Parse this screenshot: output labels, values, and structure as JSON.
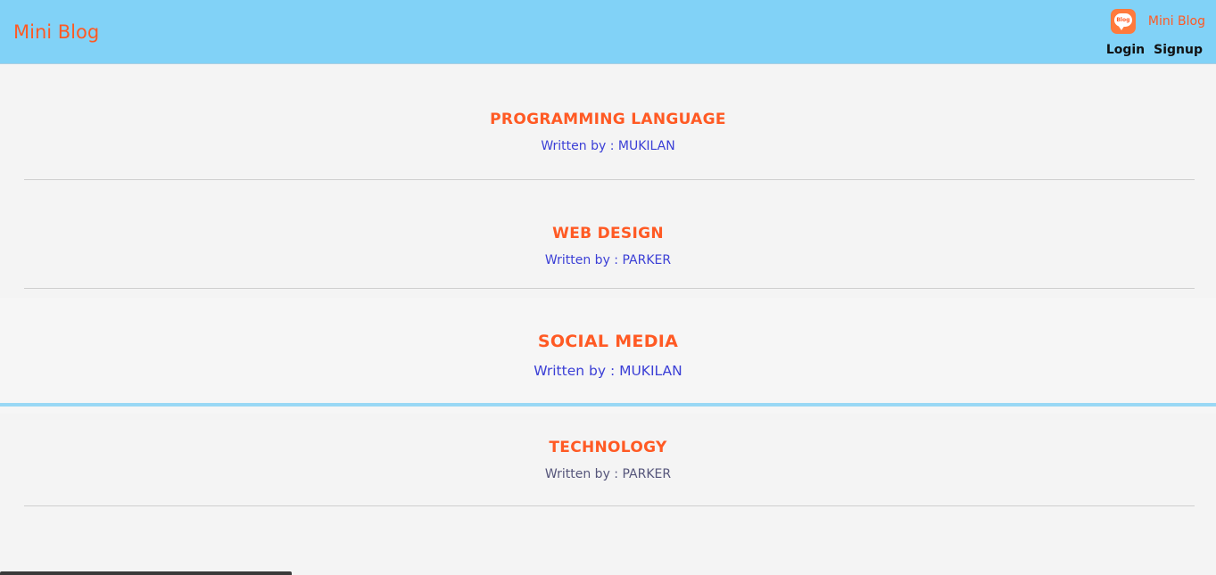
{
  "header": {
    "brand": "Mini Blog",
    "logo_label": "Blog",
    "logo_name": "Mini Blog",
    "login": "Login",
    "signup": "Signup"
  },
  "posts": [
    {
      "title": "PROGRAMMING LANGUAGE",
      "byline": "Written by : MUKILAN"
    },
    {
      "title": "WEB DESIGN",
      "byline": "Written by : PARKER"
    },
    {
      "title": "SOCIAL MEDIA",
      "byline": "Written by : MUKILAN"
    },
    {
      "title": "TECHNOLOGY",
      "byline": "Written by : PARKER"
    }
  ],
  "colors": {
    "header_bg": "#81d2f7",
    "accent": "#ff5a24",
    "byline": "#3b3fd6",
    "page_bg": "#f4f4f4"
  },
  "icons": [
    "blog-logo-icon"
  ]
}
